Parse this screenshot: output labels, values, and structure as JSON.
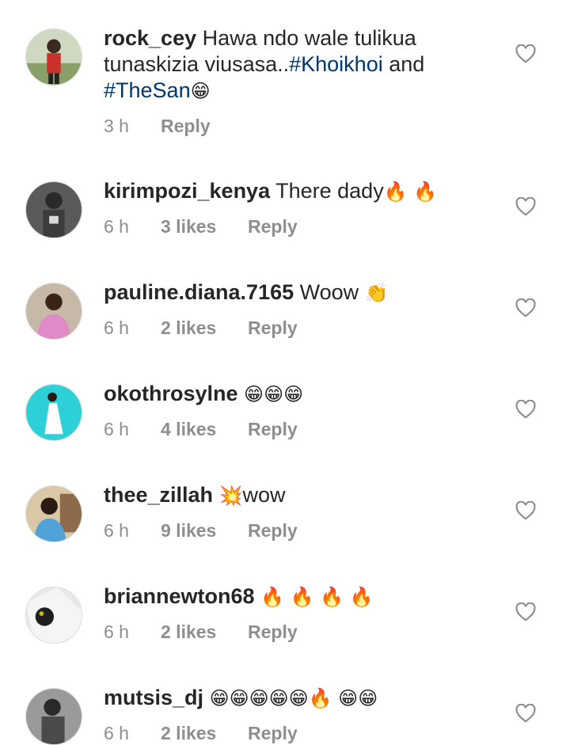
{
  "comments": [
    {
      "username": "rock_cey",
      "text_before": "Hawa ndo wale tulikua tunaskizia viusasa..",
      "hashtag1": "#Khoikhoi",
      "middle": " and ",
      "hashtag2": "#TheSan",
      "emoji": "😁",
      "time": "3 h",
      "likes": "",
      "reply": "Reply",
      "avatar_color": "#7a8b5a"
    },
    {
      "username": "kirimpozi_kenya",
      "text": "There dady",
      "emoji": "🔥 🔥",
      "time": "6 h",
      "likes": "3 likes",
      "reply": "Reply",
      "avatar_color": "#4a4a4a"
    },
    {
      "username": "pauline.diana.7165",
      "text": "Woow",
      "emoji": "👏",
      "time": "6 h",
      "likes": "2 likes",
      "reply": "Reply",
      "avatar_color": "#d98fc4"
    },
    {
      "username": "okothrosylne",
      "text": "",
      "emoji": "😁😁😁",
      "time": "6 h",
      "likes": "4 likes",
      "reply": "Reply",
      "avatar_color": "#2ed0d8"
    },
    {
      "username": "thee_zillah",
      "text": "wow",
      "emoji": "💥",
      "time": "6 h",
      "likes": "9 likes",
      "reply": "Reply",
      "avatar_color": "#8c6a4a"
    },
    {
      "username": "briannewton68",
      "text": "",
      "emoji": "🔥 🔥 🔥 🔥",
      "time": "6 h",
      "likes": "2 likes",
      "reply": "Reply",
      "avatar_color": "#6e6e6e"
    },
    {
      "username": "mutsis_dj",
      "text": "",
      "emoji": "😁😁😁😁😁🔥 😁😁",
      "time": "6 h",
      "likes": "2 likes",
      "reply": "Reply",
      "avatar_color": "#5a5a5a"
    }
  ],
  "colors": {
    "text": "#262626",
    "meta": "#8e8e8e",
    "hashtag": "#00376b",
    "heart": "#8e8e8e"
  },
  "icons": {
    "like": "heart-outline-icon"
  }
}
